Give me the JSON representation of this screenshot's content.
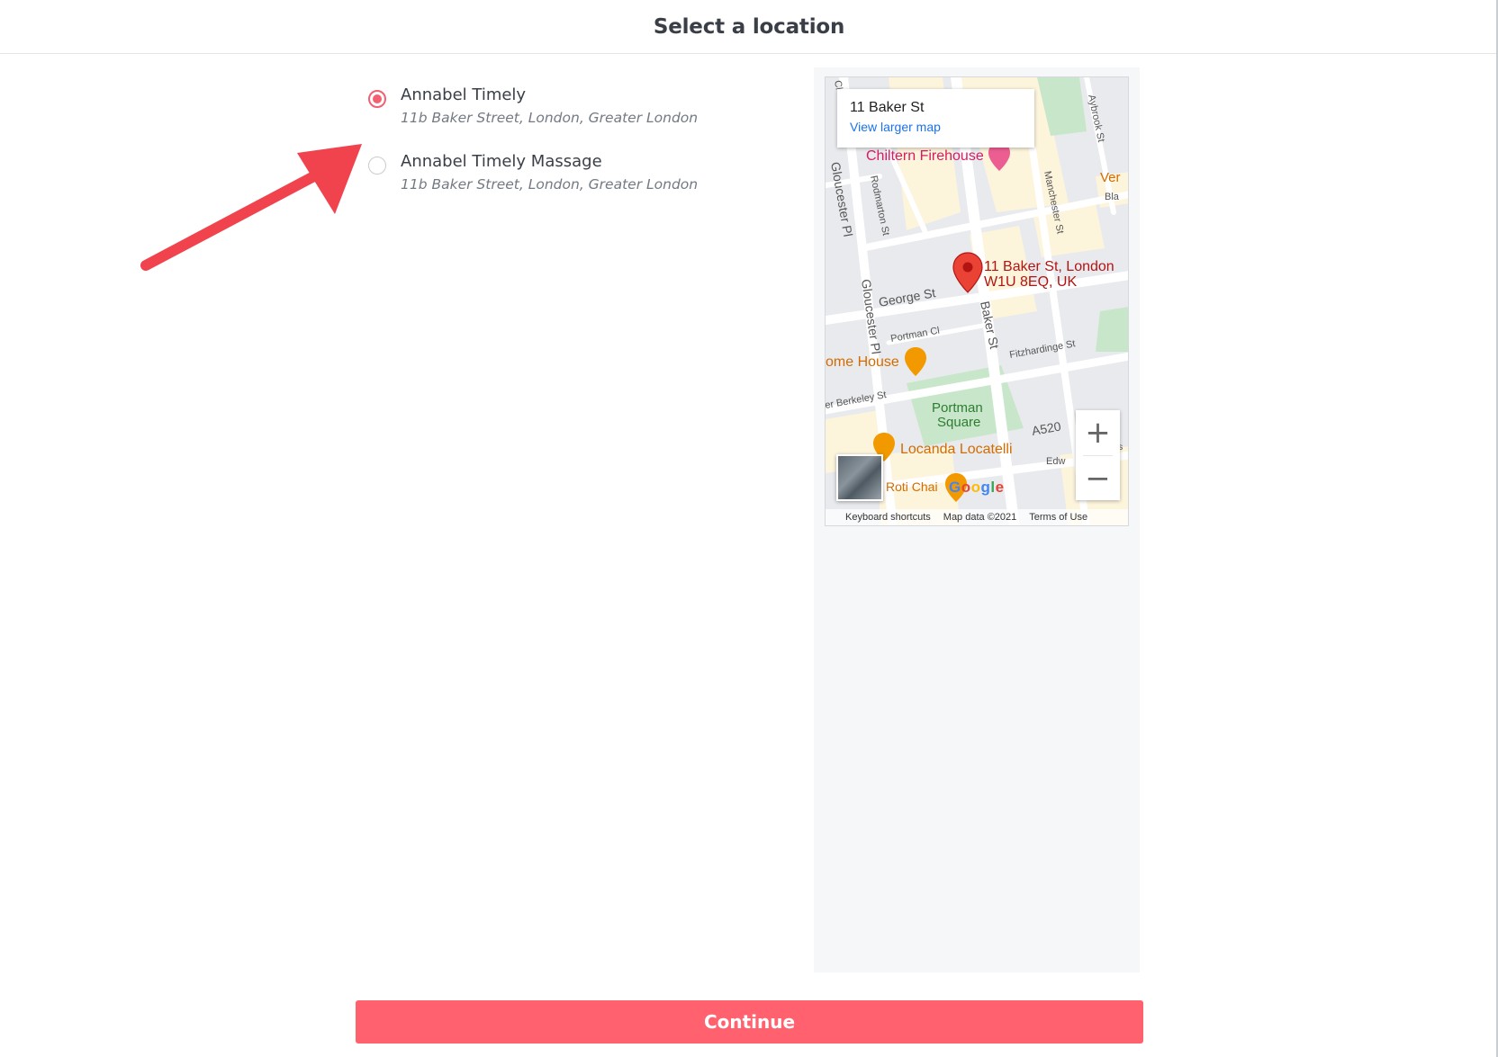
{
  "header": {
    "title": "Select a location"
  },
  "locations": [
    {
      "name": "Annabel Timely",
      "address": "11b Baker Street, London, Greater London",
      "selected": true
    },
    {
      "name": "Annabel Timely Massage",
      "address": "11b Baker Street, London, Greater London",
      "selected": false
    }
  ],
  "map": {
    "card_title": "11 Baker St",
    "card_link": "View larger map",
    "marker_line1": "11 Baker St, London",
    "marker_line2": "W1U 8EQ, UK",
    "zoom_in": "+",
    "zoom_out": "−",
    "labels": {
      "chiltern": "Chiltern Firehouse",
      "gloucester1": "Gloucester Pl",
      "gloucester2": "Gloucester Pl",
      "rodmarton": "Rodmarton St",
      "manchester": "Manchester St",
      "aybrook": "Aybrook St",
      "george": "George St",
      "baker": "Baker St",
      "portman_cl": "Portman Cl",
      "fitzhardinge": "Fitzhardinge St",
      "home_house": "ome House",
      "berkeley": "er Berkeley St",
      "portman_sq1": "Portman",
      "portman_sq2": "Square",
      "a520": "A520",
      "locanda": "Locanda Locatelli",
      "roti": "Roti Chai",
      "ver": "Ver",
      "bla": "Bla",
      "edw": "Edw",
      "cl": "Cl",
      "ws": "ws"
    },
    "footer": {
      "shortcuts": "Keyboard shortcuts",
      "data": "Map data ©2021",
      "terms": "Terms of Use"
    },
    "google": "Google"
  },
  "actions": {
    "continue_label": "Continue"
  },
  "colors": {
    "accent": "#ff616f",
    "radio": "#f26071"
  }
}
